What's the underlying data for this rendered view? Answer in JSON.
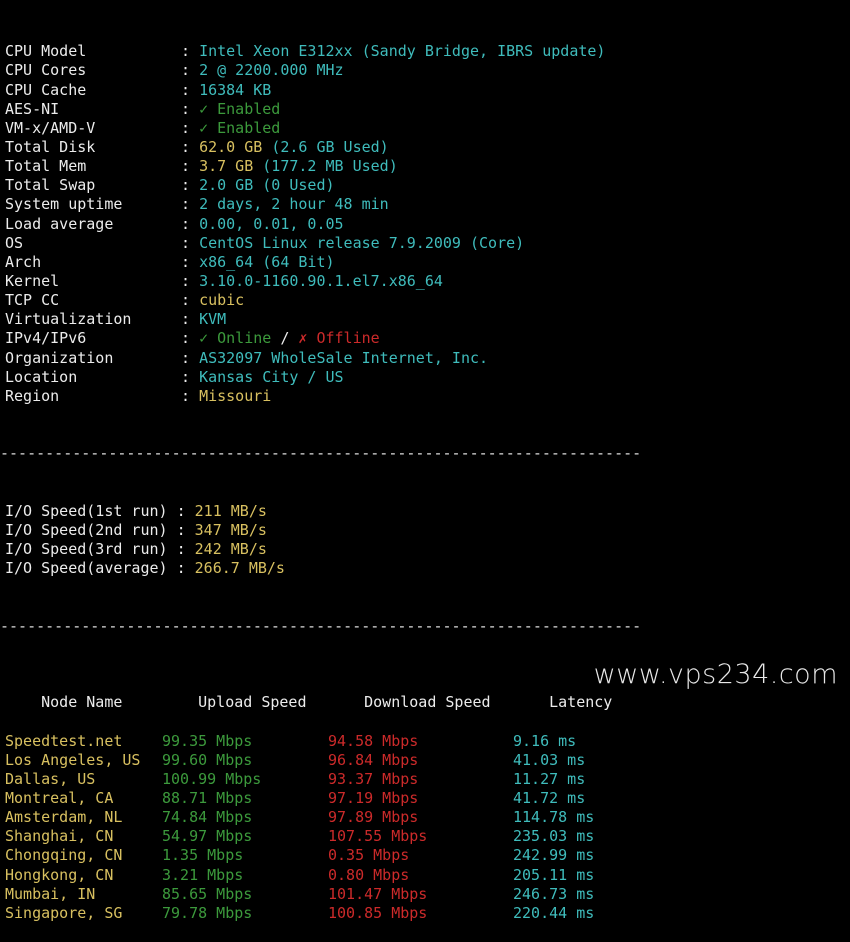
{
  "theme": {
    "background": "#000000",
    "text": "#ececec",
    "cyan": "#3fbcbc",
    "yellow": "#d8c060",
    "green": "#3c9a3c",
    "red": "#cc2a2a"
  },
  "separator": ": ",
  "dashes": "-----------------------------------------------------------------------",
  "system_info": [
    {
      "key": "CPU Model",
      "parts": [
        {
          "text": "Intel Xeon E312xx (Sandy Bridge, IBRS update)",
          "color": "cyan"
        }
      ]
    },
    {
      "key": "CPU Cores",
      "parts": [
        {
          "text": "2 @ 2200.000 MHz",
          "color": "cyan"
        }
      ]
    },
    {
      "key": "CPU Cache",
      "parts": [
        {
          "text": "16384 KB",
          "color": "cyan"
        }
      ]
    },
    {
      "key": "AES-NI",
      "parts": [
        {
          "text": "✓ Enabled",
          "color": "green"
        }
      ]
    },
    {
      "key": "VM-x/AMD-V",
      "parts": [
        {
          "text": "✓ Enabled",
          "color": "green"
        }
      ]
    },
    {
      "key": "Total Disk",
      "parts": [
        {
          "text": "62.0 GB ",
          "color": "yellow"
        },
        {
          "text": "(2.6 GB Used)",
          "color": "cyan"
        }
      ]
    },
    {
      "key": "Total Mem",
      "parts": [
        {
          "text": "3.7 GB ",
          "color": "yellow"
        },
        {
          "text": "(177.2 MB Used)",
          "color": "cyan"
        }
      ]
    },
    {
      "key": "Total Swap",
      "parts": [
        {
          "text": "2.0 GB (0 Used)",
          "color": "cyan"
        }
      ]
    },
    {
      "key": "System uptime",
      "parts": [
        {
          "text": "2 days, 2 hour 48 min",
          "color": "cyan"
        }
      ]
    },
    {
      "key": "Load average",
      "parts": [
        {
          "text": "0.00, 0.01, 0.05",
          "color": "cyan"
        }
      ]
    },
    {
      "key": "OS",
      "parts": [
        {
          "text": "CentOS Linux release 7.9.2009 (Core)",
          "color": "cyan"
        }
      ]
    },
    {
      "key": "Arch",
      "parts": [
        {
          "text": "x86_64 (64 Bit)",
          "color": "cyan"
        }
      ]
    },
    {
      "key": "Kernel",
      "parts": [
        {
          "text": "3.10.0-1160.90.1.el7.x86_64",
          "color": "cyan"
        }
      ]
    },
    {
      "key": "TCP CC",
      "parts": [
        {
          "text": "cubic",
          "color": "yellow"
        }
      ]
    },
    {
      "key": "Virtualization",
      "parts": [
        {
          "text": "KVM",
          "color": "cyan"
        }
      ]
    },
    {
      "key": "IPv4/IPv6",
      "parts": [
        {
          "text": "✓ Online",
          "color": "green"
        },
        {
          "text": " / ",
          "color": "white"
        },
        {
          "text": "✗ Offline",
          "color": "red"
        }
      ]
    },
    {
      "key": "Organization",
      "parts": [
        {
          "text": "AS32097 WholeSale Internet, Inc.",
          "color": "cyan"
        }
      ]
    },
    {
      "key": "Location",
      "parts": [
        {
          "text": "Kansas City / US",
          "color": "cyan"
        }
      ]
    },
    {
      "key": "Region",
      "parts": [
        {
          "text": "Missouri",
          "color": "yellow"
        }
      ]
    }
  ],
  "io_speed": [
    {
      "key": "I/O Speed(1st run)",
      "value": "211 MB/s"
    },
    {
      "key": "I/O Speed(2nd run)",
      "value": "347 MB/s"
    },
    {
      "key": "I/O Speed(3rd run)",
      "value": "242 MB/s"
    },
    {
      "key": "I/O Speed(average)",
      "value": "266.7 MB/s"
    }
  ],
  "speedtest": {
    "headers": [
      "Node Name",
      "Upload Speed",
      "Download Speed",
      "Latency"
    ],
    "rows": [
      {
        "node": "Speedtest.net",
        "upload": "99.35 Mbps",
        "download": "94.58 Mbps",
        "latency": "9.16 ms"
      },
      {
        "node": "Los Angeles, US",
        "upload": "99.60 Mbps",
        "download": "96.84 Mbps",
        "latency": "41.03 ms"
      },
      {
        "node": "Dallas, US",
        "upload": "100.99 Mbps",
        "download": "93.37 Mbps",
        "latency": "11.27 ms"
      },
      {
        "node": "Montreal, CA",
        "upload": "88.71 Mbps",
        "download": "97.19 Mbps",
        "latency": "41.72 ms"
      },
      {
        "node": "Amsterdam, NL",
        "upload": "74.84 Mbps",
        "download": "97.89 Mbps",
        "latency": "114.78 ms"
      },
      {
        "node": "Shanghai, CN",
        "upload": "54.97 Mbps",
        "download": "107.55 Mbps",
        "latency": "235.03 ms"
      },
      {
        "node": "Chongqing, CN",
        "upload": "1.35 Mbps",
        "download": "0.35 Mbps",
        "latency": "242.99 ms"
      },
      {
        "node": "Hongkong, CN",
        "upload": "3.21 Mbps",
        "download": "0.80 Mbps",
        "latency": "205.11 ms"
      },
      {
        "node": "Mumbai, IN",
        "upload": "85.65 Mbps",
        "download": "101.47 Mbps",
        "latency": "246.73 ms"
      },
      {
        "node": "Singapore, SG",
        "upload": "79.78 Mbps",
        "download": "100.85 Mbps",
        "latency": "220.44 ms"
      }
    ]
  },
  "watermark": "www.vps234.com"
}
